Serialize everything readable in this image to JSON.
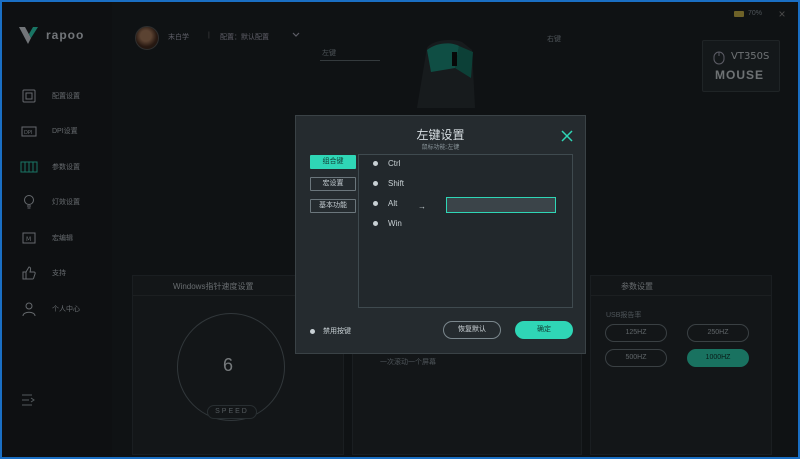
{
  "app": {
    "logo_text": "rapoo",
    "accent": "#2fd6b6",
    "border_color": "#1a6fc4"
  },
  "header": {
    "username": "末白学",
    "separator": "|",
    "profile": "配置：默认配置",
    "battery": "70%",
    "model_name": "VT350S",
    "model_sub": "MOUSE"
  },
  "sidebar": {
    "items": [
      {
        "label": "配置设置",
        "icon": "config-icon",
        "active": false
      },
      {
        "label": "DPI设置",
        "icon": "dpi-icon",
        "active": false
      },
      {
        "label": "参数设置",
        "icon": "params-icon",
        "active": true
      },
      {
        "label": "灯效设置",
        "icon": "lightbulb-icon",
        "active": false
      },
      {
        "label": "宏编辑",
        "icon": "macro-icon",
        "active": false
      },
      {
        "label": "支持",
        "icon": "thumbs-up-icon",
        "active": false
      },
      {
        "label": "个人中心",
        "icon": "user-icon",
        "active": false
      }
    ]
  },
  "background": {
    "callouts": [
      "左键",
      "右键"
    ],
    "windows_panel_title": "Windows指针速度设置",
    "speed_value": "6",
    "speed_label": "SPEED",
    "mid_text": "一次滚动一个屏幕",
    "params_panel_title": "参数设置",
    "usb_label": "USB报告率",
    "report_rates": [
      {
        "label": "125HZ",
        "selected": false
      },
      {
        "label": "250HZ",
        "selected": false
      },
      {
        "label": "500HZ",
        "selected": false
      },
      {
        "label": "1000HZ",
        "selected": true
      }
    ]
  },
  "dialog": {
    "title": "左键设置",
    "subtitle": "鼠标功能:左键",
    "tabs": [
      {
        "label": "组合键",
        "active": true
      },
      {
        "label": "宏设置",
        "active": false
      },
      {
        "label": "基本功能",
        "active": false
      }
    ],
    "options": [
      "Ctrl",
      "Shift",
      "Alt",
      "Win"
    ],
    "arrow": "→",
    "key_field_value": "",
    "disable_label": "禁用按键",
    "restore_label": "恢复默认",
    "ok_label": "确定"
  }
}
